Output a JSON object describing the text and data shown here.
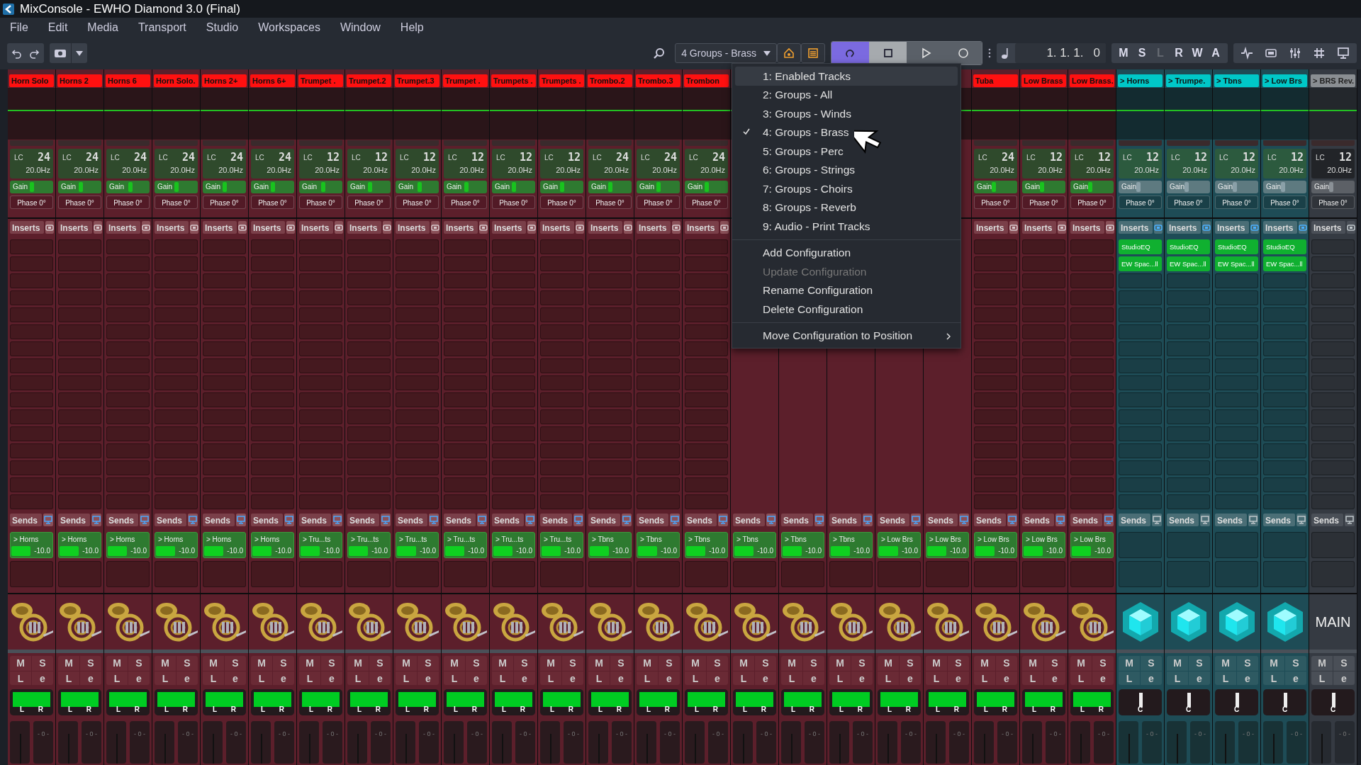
{
  "window": {
    "title": "MixConsole - EWHO Diamond 3.0 (Final)"
  },
  "menu_bar": [
    "File",
    "Edit",
    "Media",
    "Transport",
    "Studio",
    "Workspaces",
    "Window",
    "Help"
  ],
  "toolbar": {
    "config_dropdown": "4 Groups - Brass",
    "transport": [
      {
        "kind": "cycle",
        "on": true
      },
      {
        "kind": "stop",
        "on": true
      },
      {
        "kind": "play",
        "on": false
      },
      {
        "kind": "record",
        "on": false
      }
    ],
    "position": "1. 1. 1.   0",
    "global_buttons": [
      {
        "label": "M",
        "disabled": false
      },
      {
        "label": "S",
        "disabled": false
      },
      {
        "label": "L",
        "disabled": true
      },
      {
        "label": "R",
        "disabled": false
      },
      {
        "label": "W",
        "disabled": false
      },
      {
        "label": "A",
        "disabled": false
      }
    ]
  },
  "config_menu": {
    "configurations": [
      {
        "label": "1: Enabled Tracks",
        "checked": false,
        "highlighted": true
      },
      {
        "label": "2: Groups - All",
        "checked": false,
        "highlighted": false
      },
      {
        "label": "3: Groups - Winds",
        "checked": false,
        "highlighted": false
      },
      {
        "label": "4: Groups - Brass",
        "checked": true,
        "highlighted": false
      },
      {
        "label": "5: Groups - Perc",
        "checked": false,
        "highlighted": false
      },
      {
        "label": "6: Groups - Strings",
        "checked": false,
        "highlighted": false
      },
      {
        "label": "7: Groups - Choirs",
        "checked": false,
        "highlighted": false
      },
      {
        "label": "8: Groups - Reverb",
        "checked": false,
        "highlighted": false
      },
      {
        "label": "9: Audio - Print Tracks",
        "checked": false,
        "highlighted": false
      }
    ],
    "actions": [
      {
        "label": "Add Configuration",
        "disabled": false
      },
      {
        "label": "Update Configuration",
        "disabled": true
      },
      {
        "label": "Rename Configuration",
        "disabled": false
      },
      {
        "label": "Delete Configuration",
        "disabled": false
      }
    ],
    "submenu": {
      "label": "Move Configuration to Position"
    }
  },
  "channels": [
    {
      "kind": "instrument",
      "name": "Horn Solo",
      "lc": {
        "label": "LC",
        "slope": "24",
        "freq": "20.0Hz"
      },
      "gain": {
        "label": "Gain",
        "level": 0.5
      },
      "phase": "Phase 0°",
      "inserts_label": "Inserts",
      "sends_label": "Sends",
      "sends": [
        {
          "target": "> Horns",
          "value": "-10.0",
          "level": 0.45
        }
      ],
      "image": {
        "kind": "picture"
      },
      "buttons": [
        "M",
        "S",
        "L",
        "e"
      ],
      "pan": {
        "kind": "stereo",
        "labels": [
          "L",
          "R"
        ]
      },
      "fader_scale": "- 0 -"
    },
    {
      "kind": "instrument",
      "name": "Horns 2",
      "lc": {
        "label": "LC",
        "slope": "24",
        "freq": "20.0Hz"
      },
      "gain": {
        "label": "Gain",
        "level": 0.52
      },
      "phase": "Phase 0°",
      "inserts_label": "Inserts",
      "sends_label": "Sends",
      "sends": [
        {
          "target": "> Horns",
          "value": "-10.0",
          "level": 0.45
        }
      ],
      "image": {
        "kind": "picture"
      },
      "buttons": [
        "M",
        "S",
        "L",
        "e"
      ],
      "pan": {
        "kind": "stereo",
        "labels": [
          "L",
          "R"
        ]
      },
      "fader_scale": "- 0 -"
    },
    {
      "kind": "instrument",
      "name": "Horns 6",
      "lc": {
        "label": "LC",
        "slope": "24",
        "freq": "20.0Hz"
      },
      "gain": {
        "label": "Gain",
        "level": 0.55
      },
      "phase": "Phase 0°",
      "inserts_label": "Inserts",
      "sends_label": "Sends",
      "sends": [
        {
          "target": "> Horns",
          "value": "-10.0",
          "level": 0.45
        }
      ],
      "image": {
        "kind": "picture"
      },
      "buttons": [
        "M",
        "S",
        "L",
        "e"
      ],
      "pan": {
        "kind": "stereo",
        "labels": [
          "L",
          "R"
        ]
      },
      "fader_scale": "- 0 -"
    },
    {
      "kind": "instrument",
      "name": "Horn Solo.",
      "lc": {
        "label": "LC",
        "slope": "24",
        "freq": "20.0Hz"
      },
      "gain": {
        "label": "Gain",
        "level": 0.5
      },
      "phase": "Phase 0°",
      "inserts_label": "Inserts",
      "sends_label": "Sends",
      "sends": [
        {
          "target": "> Horns",
          "value": "-10.0",
          "level": 0.45
        }
      ],
      "image": {
        "kind": "picture"
      },
      "buttons": [
        "M",
        "S",
        "L",
        "e"
      ],
      "pan": {
        "kind": "stereo",
        "labels": [
          "L",
          "R"
        ]
      },
      "fader_scale": "- 0 -"
    },
    {
      "kind": "instrument",
      "name": "Horns 2+",
      "lc": {
        "label": "LC",
        "slope": "24",
        "freq": "20.0Hz"
      },
      "gain": {
        "label": "Gain",
        "level": 0.5
      },
      "phase": "Phase 0°",
      "inserts_label": "Inserts",
      "sends_label": "Sends",
      "sends": [
        {
          "target": "> Horns",
          "value": "-10.0",
          "level": 0.45
        }
      ],
      "image": {
        "kind": "picture"
      },
      "buttons": [
        "M",
        "S",
        "L",
        "e"
      ],
      "pan": {
        "kind": "stereo",
        "labels": [
          "L",
          "R"
        ]
      },
      "fader_scale": "- 0 -"
    },
    {
      "kind": "instrument",
      "name": "Horns 6+",
      "lc": {
        "label": "LC",
        "slope": "24",
        "freq": "20.0Hz"
      },
      "gain": {
        "label": "Gain",
        "level": 0.5
      },
      "phase": "Phase 0°",
      "inserts_label": "Inserts",
      "sends_label": "Sends",
      "sends": [
        {
          "target": "> Horns",
          "value": "-10.0",
          "level": 0.45
        }
      ],
      "image": {
        "kind": "picture"
      },
      "buttons": [
        "M",
        "S",
        "L",
        "e"
      ],
      "pan": {
        "kind": "stereo",
        "labels": [
          "L",
          "R"
        ]
      },
      "fader_scale": "- 0 -"
    },
    {
      "kind": "instrument",
      "name": "Trumpet .",
      "lc": {
        "label": "LC",
        "slope": "12",
        "freq": "20.0Hz"
      },
      "gain": {
        "label": "Gain",
        "level": 0.55
      },
      "phase": "Phase 0°",
      "inserts_label": "Inserts",
      "sends_label": "Sends",
      "sends": [
        {
          "target": "> Tru...ts",
          "value": "-10.0",
          "level": 0.45
        }
      ],
      "image": {
        "kind": "picture"
      },
      "buttons": [
        "M",
        "S",
        "L",
        "e"
      ],
      "pan": {
        "kind": "stereo",
        "labels": [
          "L",
          "R"
        ]
      },
      "fader_scale": "- 0 -"
    },
    {
      "kind": "instrument",
      "name": "Trumpet.2",
      "lc": {
        "label": "LC",
        "slope": "12",
        "freq": "20.0Hz"
      },
      "gain": {
        "label": "Gain",
        "level": 0.52
      },
      "phase": "Phase 0°",
      "inserts_label": "Inserts",
      "sends_label": "Sends",
      "sends": [
        {
          "target": "> Tru...ts",
          "value": "-10.0",
          "level": 0.45
        }
      ],
      "image": {
        "kind": "picture"
      },
      "buttons": [
        "M",
        "S",
        "L",
        "e"
      ],
      "pan": {
        "kind": "stereo",
        "labels": [
          "L",
          "R"
        ]
      },
      "fader_scale": "- 0 -"
    },
    {
      "kind": "instrument",
      "name": "Trumpet.3",
      "lc": {
        "label": "LC",
        "slope": "12",
        "freq": "20.0Hz"
      },
      "gain": {
        "label": "Gain",
        "level": 0.55
      },
      "phase": "Phase 0°",
      "inserts_label": "Inserts",
      "sends_label": "Sends",
      "sends": [
        {
          "target": "> Tru...ts",
          "value": "-10.0",
          "level": 0.45
        }
      ],
      "image": {
        "kind": "picture"
      },
      "buttons": [
        "M",
        "S",
        "L",
        "e"
      ],
      "pan": {
        "kind": "stereo",
        "labels": [
          "L",
          "R"
        ]
      },
      "fader_scale": "- 0 -"
    },
    {
      "kind": "instrument",
      "name": "Trumpet .",
      "lc": {
        "label": "LC",
        "slope": "12",
        "freq": "20.0Hz"
      },
      "gain": {
        "label": "Gain",
        "level": 0.52
      },
      "phase": "Phase 0°",
      "inserts_label": "Inserts",
      "sends_label": "Sends",
      "sends": [
        {
          "target": "> Tru...ts",
          "value": "-10.0",
          "level": 0.45
        }
      ],
      "image": {
        "kind": "picture"
      },
      "buttons": [
        "M",
        "S",
        "L",
        "e"
      ],
      "pan": {
        "kind": "stereo",
        "labels": [
          "L",
          "R"
        ]
      },
      "fader_scale": "- 0 -"
    },
    {
      "kind": "instrument",
      "name": "Trumpets .",
      "lc": {
        "label": "LC",
        "slope": "12",
        "freq": "20.0Hz"
      },
      "gain": {
        "label": "Gain",
        "level": 0.5
      },
      "phase": "Phase 0°",
      "inserts_label": "Inserts",
      "sends_label": "Sends",
      "sends": [
        {
          "target": "> Tru...ts",
          "value": "-10.0",
          "level": 0.45
        }
      ],
      "image": {
        "kind": "picture"
      },
      "buttons": [
        "M",
        "S",
        "L",
        "e"
      ],
      "pan": {
        "kind": "stereo",
        "labels": [
          "L",
          "R"
        ]
      },
      "fader_scale": "- 0 -"
    },
    {
      "kind": "instrument",
      "name": "Trumpets .",
      "lc": {
        "label": "LC",
        "slope": "12",
        "freq": "20.0Hz"
      },
      "gain": {
        "label": "Gain",
        "level": 0.5
      },
      "phase": "Phase 0°",
      "inserts_label": "Inserts",
      "sends_label": "Sends",
      "sends": [
        {
          "target": "> Tru...ts",
          "value": "-10.0",
          "level": 0.45
        }
      ],
      "image": {
        "kind": "picture"
      },
      "buttons": [
        "M",
        "S",
        "L",
        "e"
      ],
      "pan": {
        "kind": "stereo",
        "labels": [
          "L",
          "R"
        ]
      },
      "fader_scale": "- 0 -"
    },
    {
      "kind": "instrument",
      "name": "Trombo.2",
      "lc": {
        "label": "LC",
        "slope": "24",
        "freq": "20.0Hz"
      },
      "gain": {
        "label": "Gain",
        "level": 0.5
      },
      "phase": "Phase 0°",
      "inserts_label": "Inserts",
      "sends_label": "Sends",
      "sends": [
        {
          "target": "> Tbns",
          "value": "-10.0",
          "level": 0.45
        }
      ],
      "image": {
        "kind": "picture"
      },
      "buttons": [
        "M",
        "S",
        "L",
        "e"
      ],
      "pan": {
        "kind": "stereo",
        "labels": [
          "L",
          "R"
        ]
      },
      "fader_scale": "- 0 -"
    },
    {
      "kind": "instrument",
      "name": "Trombo.3",
      "lc": {
        "label": "LC",
        "slope": "24",
        "freq": "20.0Hz"
      },
      "gain": {
        "label": "Gain",
        "level": 0.5
      },
      "phase": "Phase 0°",
      "inserts_label": "Inserts",
      "sends_label": "Sends",
      "sends": [
        {
          "target": "> Tbns",
          "value": "-10.0",
          "level": 0.45
        }
      ],
      "image": {
        "kind": "picture"
      },
      "buttons": [
        "M",
        "S",
        "L",
        "e"
      ],
      "pan": {
        "kind": "stereo",
        "labels": [
          "L",
          "R"
        ]
      },
      "fader_scale": "- 0 -"
    },
    {
      "kind": "instrument",
      "name": "Trombon",
      "lc": {
        "label": "LC",
        "slope": "24",
        "freq": "20.0Hz"
      },
      "gain": {
        "label": "Gain",
        "level": 0.5
      },
      "phase": "Phase 0°",
      "inserts_label": "Inserts",
      "sends_label": "Sends",
      "sends": [
        {
          "target": "> Tbns",
          "value": "-10.0",
          "level": 0.45
        }
      ],
      "image": {
        "kind": "picture"
      },
      "buttons": [
        "M",
        "S",
        "L",
        "e"
      ],
      "pan": {
        "kind": "stereo",
        "labels": [
          "L",
          "R"
        ]
      },
      "fader_scale": "- 0 -"
    },
    {
      "kind": "instrument",
      "sends_label": "Sends",
      "sends": [
        {
          "target": "> Tbns",
          "value": "-10.0",
          "level": 0.45
        }
      ],
      "image": {
        "kind": "picture"
      },
      "buttons": [
        "M",
        "S",
        "L",
        "e"
      ],
      "pan": {
        "kind": "stereo",
        "labels": [
          "L",
          "R"
        ]
      },
      "fader_scale": "- 0 -"
    },
    {
      "kind": "instrument",
      "sends_label": "Sends",
      "sends": [
        {
          "target": "> Tbns",
          "value": "-10.0",
          "level": 0.45
        }
      ],
      "image": {
        "kind": "picture"
      },
      "buttons": [
        "M",
        "S",
        "L",
        "e"
      ],
      "pan": {
        "kind": "stereo",
        "labels": [
          "L",
          "R"
        ]
      },
      "fader_scale": "- 0 -"
    },
    {
      "kind": "instrument",
      "sends_label": "Sends",
      "sends": [
        {
          "target": "> Tbns",
          "value": "-10.0",
          "level": 0.45
        }
      ],
      "image": {
        "kind": "picture"
      },
      "buttons": [
        "M",
        "S",
        "L",
        "e"
      ],
      "pan": {
        "kind": "stereo",
        "labels": [
          "L",
          "R"
        ]
      },
      "fader_scale": "- 0 -"
    },
    {
      "kind": "instrument",
      "sends_label": "Sends",
      "sends": [
        {
          "target": "> Low Brs",
          "value": "-10.0",
          "level": 0.45
        }
      ],
      "image": {
        "kind": "picture"
      },
      "buttons": [
        "M",
        "S",
        "L",
        "e"
      ],
      "pan": {
        "kind": "stereo",
        "labels": [
          "L",
          "R"
        ]
      },
      "fader_scale": "- 0 -"
    },
    {
      "kind": "instrument",
      "sends_label": "Sends",
      "sends": [
        {
          "target": "> Low Brs",
          "value": "-10.0",
          "level": 0.45
        }
      ],
      "image": {
        "kind": "picture"
      },
      "buttons": [
        "M",
        "S",
        "L",
        "e"
      ],
      "pan": {
        "kind": "stereo",
        "labels": [
          "L",
          "R"
        ]
      },
      "fader_scale": "- 0 -"
    },
    {
      "kind": "instrument",
      "name": "Tuba",
      "lc": {
        "label": "LC",
        "slope": "24",
        "freq": "20.0Hz"
      },
      "gain": {
        "label": "Gain",
        "level": 0.45
      },
      "phase": "Phase 0°",
      "inserts_label": "Inserts",
      "sends_label": "Sends",
      "sends": [
        {
          "target": "> Low Brs",
          "value": "-10.0",
          "level": 0.45
        }
      ],
      "image": {
        "kind": "picture"
      },
      "buttons": [
        "M",
        "S",
        "L",
        "e"
      ],
      "pan": {
        "kind": "stereo",
        "labels": [
          "L",
          "R"
        ]
      },
      "fader_scale": "- 0 -"
    },
    {
      "kind": "instrument",
      "name": "Low Brass",
      "lc": {
        "label": "LC",
        "slope": "12",
        "freq": "20.0Hz"
      },
      "gain": {
        "label": "Gain",
        "level": 0.45
      },
      "phase": "Phase 0°",
      "inserts_label": "Inserts",
      "sends_label": "Sends",
      "sends": [
        {
          "target": "> Low Brs",
          "value": "-10.0",
          "level": 0.45
        }
      ],
      "image": {
        "kind": "picture"
      },
      "buttons": [
        "M",
        "S",
        "L",
        "e"
      ],
      "pan": {
        "kind": "stereo",
        "labels": [
          "L",
          "R"
        ]
      },
      "fader_scale": "- 0 -"
    },
    {
      "kind": "instrument",
      "name": "Low Brass.",
      "lc": {
        "label": "LC",
        "slope": "12",
        "freq": "20.0Hz"
      },
      "gain": {
        "label": "Gain",
        "level": 0.45
      },
      "phase": "Phase 0°",
      "inserts_label": "Inserts",
      "sends_label": "Sends",
      "sends": [
        {
          "target": "> Low Brs",
          "value": "-10.0",
          "level": 0.45
        }
      ],
      "image": {
        "kind": "picture"
      },
      "buttons": [
        "M",
        "S",
        "L",
        "e"
      ],
      "pan": {
        "kind": "stereo",
        "labels": [
          "L",
          "R"
        ]
      },
      "fader_scale": "- 0 -"
    },
    {
      "kind": "group",
      "name": "> Horns",
      "lc": {
        "label": "LC",
        "slope": "12",
        "freq": "20.0Hz"
      },
      "gain": {
        "label": "Gain",
        "level": 0.45
      },
      "phase": "Phase 0°",
      "inserts_label": "Inserts",
      "inserts": [
        "StudioEQ",
        "EW Spac...ll"
      ],
      "sends_label": "Sends",
      "image": {
        "kind": "cube"
      },
      "buttons": [
        "M",
        "S",
        "L",
        "e"
      ],
      "pan": {
        "kind": "center",
        "labels": [
          "C"
        ]
      },
      "fader_scale": "- 0 -"
    },
    {
      "kind": "group",
      "name": "> Trumpe.",
      "lc": {
        "label": "LC",
        "slope": "12",
        "freq": "20.0Hz"
      },
      "gain": {
        "label": "Gain",
        "level": 0.45
      },
      "phase": "Phase 0°",
      "inserts_label": "Inserts",
      "inserts": [
        "StudioEQ",
        "EW Spac...ll"
      ],
      "sends_label": "Sends",
      "image": {
        "kind": "cube"
      },
      "buttons": [
        "M",
        "S",
        "L",
        "e"
      ],
      "pan": {
        "kind": "center",
        "labels": [
          "C"
        ]
      },
      "fader_scale": "- 0 -"
    },
    {
      "kind": "group",
      "name": "> Tbns",
      "lc": {
        "label": "LC",
        "slope": "12",
        "freq": "20.0Hz"
      },
      "gain": {
        "label": "Gain",
        "level": 0.45
      },
      "phase": "Phase 0°",
      "inserts_label": "Inserts",
      "inserts": [
        "StudioEQ",
        "EW Spac...ll"
      ],
      "sends_label": "Sends",
      "image": {
        "kind": "cube"
      },
      "buttons": [
        "M",
        "S",
        "L",
        "e"
      ],
      "pan": {
        "kind": "center",
        "labels": [
          "C"
        ]
      },
      "fader_scale": "- 0 -"
    },
    {
      "kind": "group",
      "name": "> Low Brs",
      "lc": {
        "label": "LC",
        "slope": "12",
        "freq": "20.0Hz"
      },
      "gain": {
        "label": "Gain",
        "level": 0.45
      },
      "phase": "Phase 0°",
      "inserts_label": "Inserts",
      "inserts": [
        "StudioEQ",
        "EW Spac...ll"
      ],
      "sends_label": "Sends",
      "image": {
        "kind": "cube"
      },
      "buttons": [
        "M",
        "S",
        "L",
        "e"
      ],
      "pan": {
        "kind": "center",
        "labels": [
          "C"
        ]
      },
      "fader_scale": "- 0 -"
    },
    {
      "kind": "fx",
      "name": "> BRS Rev.",
      "lc": {
        "label": "LC",
        "slope": "12",
        "freq": "20.0Hz"
      },
      "gain": {
        "label": "Gain",
        "level": 0.45
      },
      "phase": "Phase 0°",
      "inserts_label": "Inserts",
      "sends_label": "Sends",
      "image": {
        "kind": "text",
        "text": "MAIN"
      },
      "buttons": [
        "M",
        "S",
        "L",
        "e"
      ],
      "pan": {
        "kind": "center",
        "labels": [
          "C"
        ]
      },
      "fader_scale": "- 0 -"
    }
  ]
}
